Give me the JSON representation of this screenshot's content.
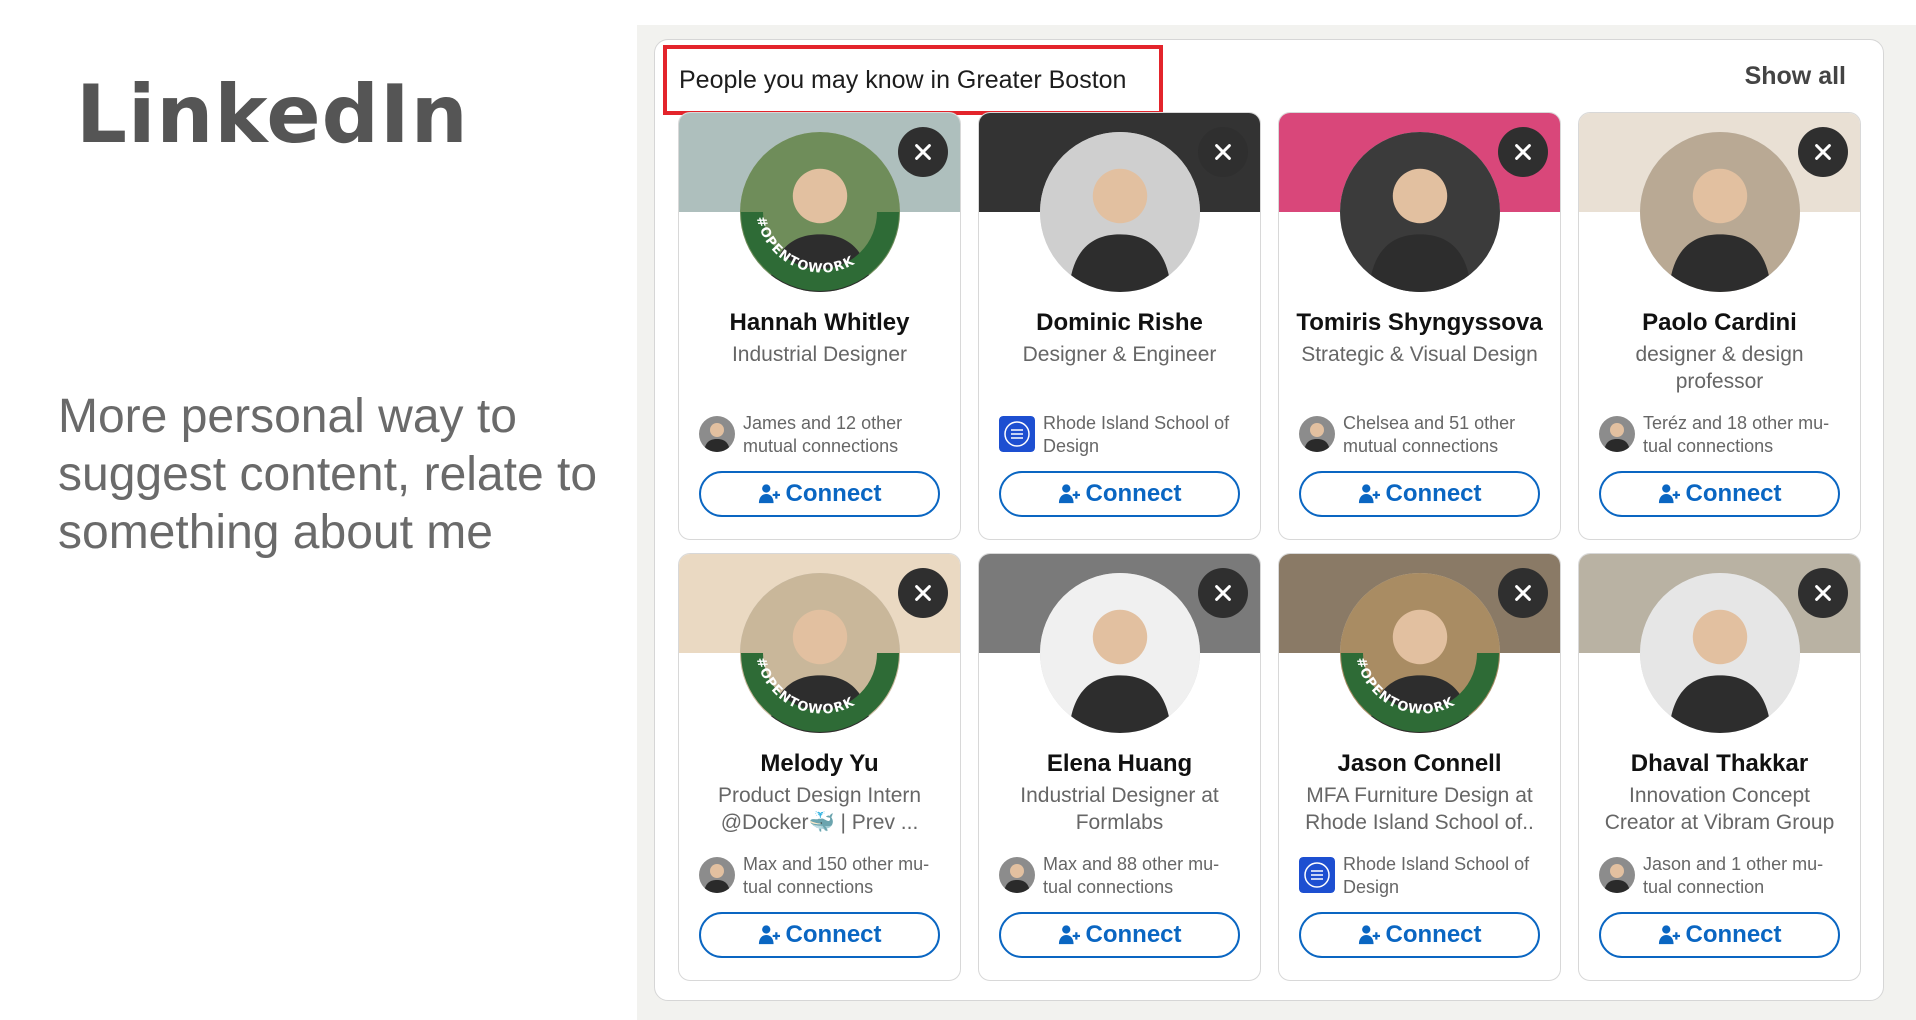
{
  "slide": {
    "title": "LinkedIn",
    "body": "More personal way to suggest content, relate to something about me"
  },
  "panel": {
    "heading": "People you may know in Greater Boston",
    "show_all": "Show all",
    "connect_label": "Connect",
    "colors": {
      "accent": "#0a66c2",
      "highlight_box": "#e3242b",
      "open_to_work": "#2e6b36"
    }
  },
  "people": [
    {
      "name": "Hannah Whitley",
      "headline": "Industrial Designer",
      "mutual": "James and 12 other mutual connections",
      "open_to_work": true,
      "banner": "#aebfbd",
      "avatar_bg": "#6f8d5a",
      "mutual_icon": "person"
    },
    {
      "name": "Dominic Rishe",
      "headline": "Designer & Engineer",
      "mutual": "Rhode Island School of Design",
      "open_to_work": false,
      "banner": "#333333",
      "avatar_bg": "#cfcfcf",
      "mutual_icon": "risd"
    },
    {
      "name": "Tomiris Shyngyssova",
      "headline": "Strategic & Visual Design",
      "mutual": "Chelsea and 51 other mutual connections",
      "open_to_work": false,
      "banner": "#d9477a",
      "avatar_bg": "#3b3b3b",
      "mutual_icon": "person"
    },
    {
      "name": "Paolo Cardini",
      "headline": "designer & design professor",
      "mutual": "Teréz and 18 other mu-tual connections",
      "open_to_work": false,
      "banner": "#e9e0d4",
      "avatar_bg": "#b9a994",
      "mutual_icon": "person"
    },
    {
      "name": "Melody Yu",
      "headline": "Product Design Intern @Docker🐳 | Prev ...",
      "mutual": "Max and 150 other mu-tual connections",
      "open_to_work": true,
      "banner": "#ead9c2",
      "avatar_bg": "#c9b79a",
      "mutual_icon": "person"
    },
    {
      "name": "Elena Huang",
      "headline": "Industrial Designer at Formlabs",
      "mutual": "Max and 88 other mu-tual connections",
      "open_to_work": false,
      "banner": "#7a7a7a",
      "avatar_bg": "#f0f0f0",
      "mutual_icon": "person"
    },
    {
      "name": "Jason Connell",
      "headline": "MFA Furniture Design at Rhode Island School of..",
      "mutual": "Rhode Island School of Design",
      "open_to_work": true,
      "banner": "#8a7a66",
      "avatar_bg": "#a98c63",
      "mutual_icon": "risd"
    },
    {
      "name": "Dhaval Thakkar",
      "headline": "Innovation Concept Creator at Vibram Group",
      "mutual": "Jason and 1 other mu-tual connection",
      "open_to_work": false,
      "banner": "#b9b2a3",
      "avatar_bg": "#e6e6e6",
      "mutual_icon": "person"
    }
  ]
}
